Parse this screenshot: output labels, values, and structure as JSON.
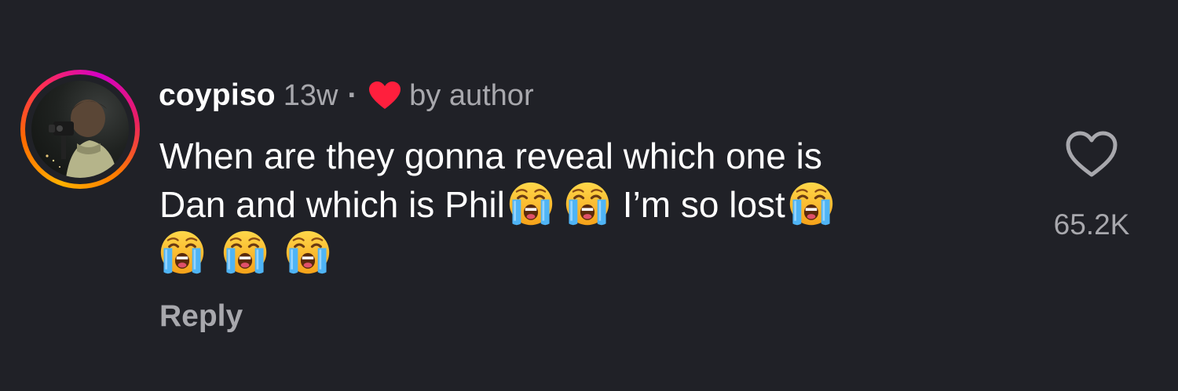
{
  "comment": {
    "username": "coypiso",
    "time_ago": "13w",
    "separator": "·",
    "author_like_label": "by author",
    "text": {
      "line1": "When are they gonna reveal which one is",
      "line2_a": "Dan and which is Phil",
      "line2_b": "I’m so lost"
    },
    "emoji_name": "loudly-crying-face",
    "reply_label": "Reply",
    "like_count": "65.2K"
  },
  "colors": {
    "background": "#202127",
    "primary_text": "#ffffff",
    "secondary_text": "#a8a8ad",
    "heart_red": "#ff1f3d",
    "story_ring_start": "#ffb000",
    "story_ring_end": "#d300c5"
  },
  "icons": {
    "author_heart": "heart-filled-icon",
    "like": "heart-outline-icon",
    "avatar": "profile-photo"
  }
}
